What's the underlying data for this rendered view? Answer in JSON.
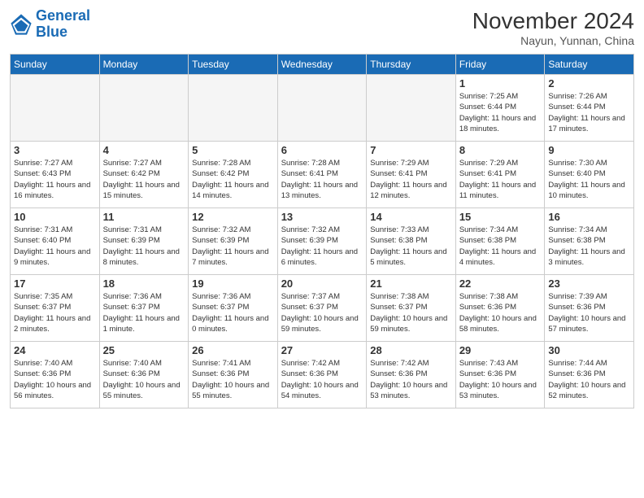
{
  "header": {
    "logo_line1": "General",
    "logo_line2": "Blue",
    "month_title": "November 2024",
    "subtitle": "Nayun, Yunnan, China"
  },
  "days_of_week": [
    "Sunday",
    "Monday",
    "Tuesday",
    "Wednesday",
    "Thursday",
    "Friday",
    "Saturday"
  ],
  "weeks": [
    [
      {
        "day": "",
        "info": ""
      },
      {
        "day": "",
        "info": ""
      },
      {
        "day": "",
        "info": ""
      },
      {
        "day": "",
        "info": ""
      },
      {
        "day": "",
        "info": ""
      },
      {
        "day": "1",
        "info": "Sunrise: 7:25 AM\nSunset: 6:44 PM\nDaylight: 11 hours and 18 minutes."
      },
      {
        "day": "2",
        "info": "Sunrise: 7:26 AM\nSunset: 6:44 PM\nDaylight: 11 hours and 17 minutes."
      }
    ],
    [
      {
        "day": "3",
        "info": "Sunrise: 7:27 AM\nSunset: 6:43 PM\nDaylight: 11 hours and 16 minutes."
      },
      {
        "day": "4",
        "info": "Sunrise: 7:27 AM\nSunset: 6:42 PM\nDaylight: 11 hours and 15 minutes."
      },
      {
        "day": "5",
        "info": "Sunrise: 7:28 AM\nSunset: 6:42 PM\nDaylight: 11 hours and 14 minutes."
      },
      {
        "day": "6",
        "info": "Sunrise: 7:28 AM\nSunset: 6:41 PM\nDaylight: 11 hours and 13 minutes."
      },
      {
        "day": "7",
        "info": "Sunrise: 7:29 AM\nSunset: 6:41 PM\nDaylight: 11 hours and 12 minutes."
      },
      {
        "day": "8",
        "info": "Sunrise: 7:29 AM\nSunset: 6:41 PM\nDaylight: 11 hours and 11 minutes."
      },
      {
        "day": "9",
        "info": "Sunrise: 7:30 AM\nSunset: 6:40 PM\nDaylight: 11 hours and 10 minutes."
      }
    ],
    [
      {
        "day": "10",
        "info": "Sunrise: 7:31 AM\nSunset: 6:40 PM\nDaylight: 11 hours and 9 minutes."
      },
      {
        "day": "11",
        "info": "Sunrise: 7:31 AM\nSunset: 6:39 PM\nDaylight: 11 hours and 8 minutes."
      },
      {
        "day": "12",
        "info": "Sunrise: 7:32 AM\nSunset: 6:39 PM\nDaylight: 11 hours and 7 minutes."
      },
      {
        "day": "13",
        "info": "Sunrise: 7:32 AM\nSunset: 6:39 PM\nDaylight: 11 hours and 6 minutes."
      },
      {
        "day": "14",
        "info": "Sunrise: 7:33 AM\nSunset: 6:38 PM\nDaylight: 11 hours and 5 minutes."
      },
      {
        "day": "15",
        "info": "Sunrise: 7:34 AM\nSunset: 6:38 PM\nDaylight: 11 hours and 4 minutes."
      },
      {
        "day": "16",
        "info": "Sunrise: 7:34 AM\nSunset: 6:38 PM\nDaylight: 11 hours and 3 minutes."
      }
    ],
    [
      {
        "day": "17",
        "info": "Sunrise: 7:35 AM\nSunset: 6:37 PM\nDaylight: 11 hours and 2 minutes."
      },
      {
        "day": "18",
        "info": "Sunrise: 7:36 AM\nSunset: 6:37 PM\nDaylight: 11 hours and 1 minute."
      },
      {
        "day": "19",
        "info": "Sunrise: 7:36 AM\nSunset: 6:37 PM\nDaylight: 11 hours and 0 minutes."
      },
      {
        "day": "20",
        "info": "Sunrise: 7:37 AM\nSunset: 6:37 PM\nDaylight: 10 hours and 59 minutes."
      },
      {
        "day": "21",
        "info": "Sunrise: 7:38 AM\nSunset: 6:37 PM\nDaylight: 10 hours and 59 minutes."
      },
      {
        "day": "22",
        "info": "Sunrise: 7:38 AM\nSunset: 6:36 PM\nDaylight: 10 hours and 58 minutes."
      },
      {
        "day": "23",
        "info": "Sunrise: 7:39 AM\nSunset: 6:36 PM\nDaylight: 10 hours and 57 minutes."
      }
    ],
    [
      {
        "day": "24",
        "info": "Sunrise: 7:40 AM\nSunset: 6:36 PM\nDaylight: 10 hours and 56 minutes."
      },
      {
        "day": "25",
        "info": "Sunrise: 7:40 AM\nSunset: 6:36 PM\nDaylight: 10 hours and 55 minutes."
      },
      {
        "day": "26",
        "info": "Sunrise: 7:41 AM\nSunset: 6:36 PM\nDaylight: 10 hours and 55 minutes."
      },
      {
        "day": "27",
        "info": "Sunrise: 7:42 AM\nSunset: 6:36 PM\nDaylight: 10 hours and 54 minutes."
      },
      {
        "day": "28",
        "info": "Sunrise: 7:42 AM\nSunset: 6:36 PM\nDaylight: 10 hours and 53 minutes."
      },
      {
        "day": "29",
        "info": "Sunrise: 7:43 AM\nSunset: 6:36 PM\nDaylight: 10 hours and 53 minutes."
      },
      {
        "day": "30",
        "info": "Sunrise: 7:44 AM\nSunset: 6:36 PM\nDaylight: 10 hours and 52 minutes."
      }
    ]
  ]
}
